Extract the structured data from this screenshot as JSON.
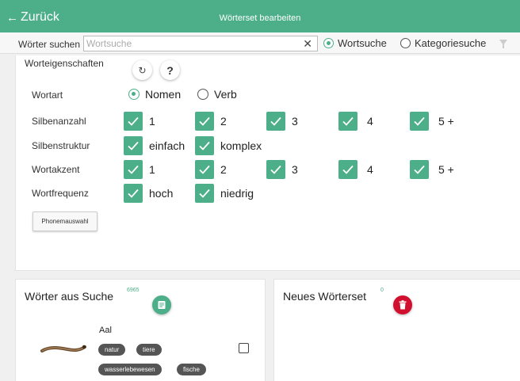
{
  "header": {
    "back_label": "Zurück",
    "title": "Wörterset bearbeiten",
    "accent": "#4caf8a"
  },
  "search": {
    "label": "Wörter suchen",
    "placeholder": "Wortsuche",
    "value": "",
    "modes": [
      {
        "label": "Wortsuche",
        "selected": true
      },
      {
        "label": "Kategoriesuche",
        "selected": false
      }
    ]
  },
  "properties": {
    "title": "Worteigenschaften",
    "wortart": {
      "label": "Wortart",
      "options": [
        "Nomen",
        "Verb"
      ],
      "selected": "Nomen"
    },
    "silbenanzahl": {
      "label": "Silbenanzahl",
      "options": [
        "1",
        "2",
        "3",
        "4",
        "5 +"
      ]
    },
    "silbenstruktur": {
      "label": "Silbenstruktur",
      "options": [
        "einfach",
        "komplex"
      ]
    },
    "wortakzent": {
      "label": "Wortakzent",
      "options": [
        "1",
        "2",
        "3",
        "4",
        "5 +"
      ]
    },
    "wortfrequenz": {
      "label": "Wortfrequenz",
      "options": [
        "hoch",
        "niedrig"
      ]
    },
    "phoneme_button": "Phonemauswahl"
  },
  "results": {
    "title": "Wörter aus Suche",
    "count": "6965",
    "items": [
      {
        "word": "Aal",
        "tags": [
          "natur",
          "tiere",
          "wasserlebewesen",
          "fische"
        ],
        "checked": false
      }
    ]
  },
  "new_set": {
    "title": "Neues Wörterset",
    "count": "0",
    "delete_color": "#d0102e"
  }
}
